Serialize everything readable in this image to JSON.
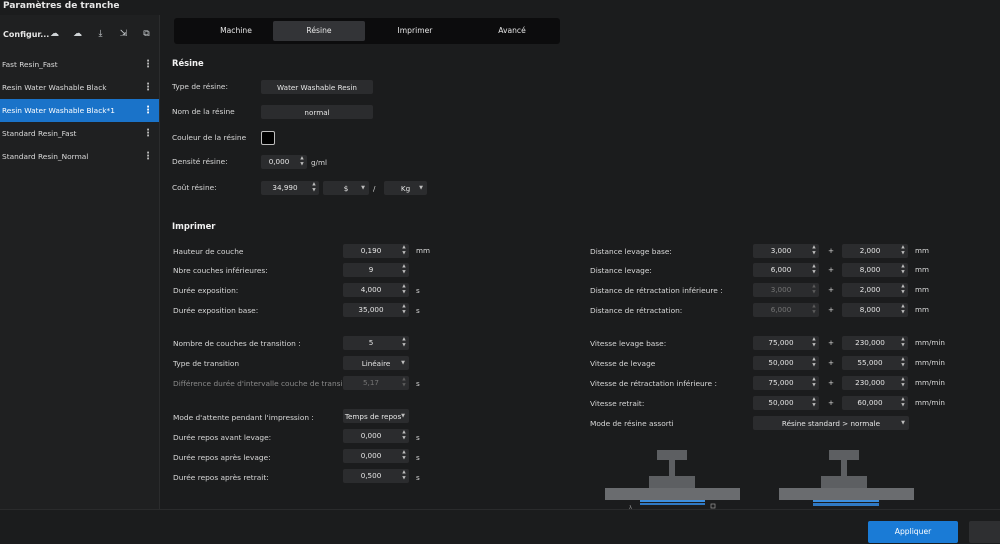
{
  "window": {
    "title": "Paramètres de tranche"
  },
  "sidebar": {
    "header_label": "Configur...",
    "header_icons": [
      "cloud-upload-icon",
      "cloud-download-icon",
      "import-icon",
      "export-icon",
      "copy-icon"
    ],
    "items": [
      {
        "label": "Fast Resin_Fast",
        "selected": false
      },
      {
        "label": "Resin Water Washable Black",
        "selected": false
      },
      {
        "label": "Resin Water Washable Black*1",
        "selected": true
      },
      {
        "label": "Standard Resin_Fast",
        "selected": false
      },
      {
        "label": "Standard Resin_Normal",
        "selected": false
      }
    ]
  },
  "tabs": [
    {
      "label": "Machine",
      "active": false
    },
    {
      "label": "Résine",
      "active": true
    },
    {
      "label": "Imprimer",
      "active": false
    },
    {
      "label": "Avancé",
      "active": false
    }
  ],
  "resin": {
    "section_title": "Résine",
    "type_label": "Type de résine:",
    "type_value": "Water Washable Resin",
    "name_label": "Nom de la résine",
    "name_value": "normal",
    "color_label": "Couleur de la résine",
    "color_value": "#000000",
    "density_label": "Densité résine:",
    "density_value": "0,000",
    "density_unit": "g/ml",
    "cost_label": "Coût résine:",
    "cost_value": "34,990",
    "currency": "$",
    "slash": "/",
    "weight_unit": "Kg"
  },
  "print": {
    "section_title": "Imprimer",
    "layer_height": {
      "label": "Hauteur de couche",
      "value": "0,190",
      "unit": "mm"
    },
    "bottom_layers": {
      "label": "Nbre couches inférieures:",
      "value": "9"
    },
    "exposure": {
      "label": "Durée exposition:",
      "value": "4,000",
      "unit": "s"
    },
    "bottom_exposure": {
      "label": "Durée exposition base:",
      "value": "35,000",
      "unit": "s"
    },
    "transition_layers": {
      "label": "Nombre de couches de transition :",
      "value": "5"
    },
    "transition_type": {
      "label": "Type de transition",
      "value": "Linéaire"
    },
    "interval_diff": {
      "label": "Différence durée d'intervalle couche de transi...",
      "value": "5,17",
      "unit": "s"
    },
    "wait_mode": {
      "label": "Mode d'attente pendant l'impression :",
      "value": "Temps de repos"
    },
    "rest_before_lift": {
      "label": "Durée repos avant levage:",
      "value": "0,000",
      "unit": "s"
    },
    "rest_after_lift": {
      "label": "Durée repos après levage:",
      "value": "0,000",
      "unit": "s"
    },
    "rest_after_retract": {
      "label": "Durée repos après retrait:",
      "value": "0,500",
      "unit": "s"
    }
  },
  "motion": {
    "plus": "+",
    "bottom_lift_dist": {
      "label": "Distance levage base:",
      "a": "3,000",
      "b": "2,000",
      "unit": "mm"
    },
    "lift_dist": {
      "label": "Distance levage:",
      "a": "6,000",
      "b": "8,000",
      "unit": "mm"
    },
    "bottom_retract_dist": {
      "label": "Distance de rétractation inférieure :",
      "a": "3,000",
      "b": "2,000",
      "unit": "mm"
    },
    "retract_dist": {
      "label": "Distance de rétractation:",
      "a": "6,000",
      "b": "8,000",
      "unit": "mm"
    },
    "bottom_lift_speed": {
      "label": "Vitesse levage base:",
      "a": "75,000",
      "b": "230,000",
      "unit": "mm/min"
    },
    "lift_speed": {
      "label": "Vitesse de levage",
      "a": "50,000",
      "b": "55,000",
      "unit": "mm/min"
    },
    "bottom_retract_speed": {
      "label": "Vitesse de rétractation inférieure :",
      "a": "75,000",
      "b": "230,000",
      "unit": "mm/min"
    },
    "retract_speed": {
      "label": "Vitesse retrait:",
      "a": "50,000",
      "b": "60,000",
      "unit": "mm/min"
    },
    "resin_mode": {
      "label": "Mode de résine assorti",
      "value": "Résine standard > normale"
    }
  },
  "footer": {
    "apply_label": "Appliquer"
  },
  "colors": {
    "accent": "#1a73c9",
    "apply": "#1a7bd6",
    "background": "#1b1c1d",
    "field": "#2b2c2e"
  }
}
